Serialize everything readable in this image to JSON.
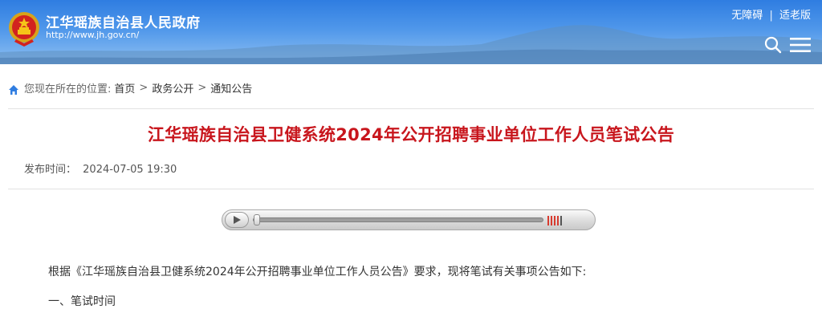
{
  "header": {
    "site_name": "江华瑶族自治县人民政府",
    "site_url": "http://www.jh.gov.cn/",
    "accessibility_label": "无障碍",
    "separator": "|",
    "elderly_label": "适老版"
  },
  "breadcrumb": {
    "prefix": "您现在所在的位置:",
    "items": [
      "首页",
      "政务公开",
      "通知公告"
    ],
    "arrow": ">"
  },
  "article": {
    "title": "江华瑶族自治县卫健系统2024年公开招聘事业单位工作人员笔试公告",
    "publish_label": "发布时间：",
    "publish_time": "2024-07-05 19:30",
    "paragraphs": [
      "根据《江华瑶族自治县卫健系统2024年公开招聘事业单位工作人员公告》要求，现将笔试有关事项公告如下:",
      "一、笔试时间"
    ]
  },
  "audio_player": {
    "progress": 0.0,
    "volume_level": 0.8
  },
  "colors": {
    "header_blue": "#2f7de1",
    "title_red": "#c8161d",
    "volume_red": "#d83a2e"
  }
}
